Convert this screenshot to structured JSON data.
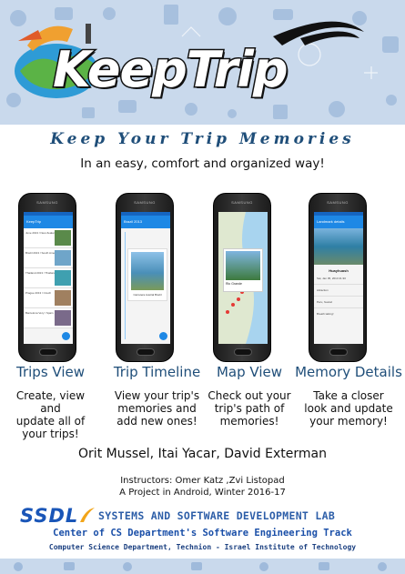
{
  "logo": {
    "title": "KeepTrip"
  },
  "tagline": "Keep Your Trip Memories",
  "subtagline": "In an easy, comfort and organized way!",
  "phones": [
    {
      "brand": "SAMSUNG",
      "app_title": "KeepTrip",
      "trips": [
        "June 2013 / New Zealand",
        "Brazil 2013 / South America",
        "Thailand 2013 / Thailand",
        "Prague 2013 / Czech",
        "Barcelona Very / Spain"
      ]
    },
    {
      "brand": "SAMSUNG",
      "app_title": "Brazil 2013",
      "memory_title": "Carretera Austral Brazil"
    },
    {
      "brand": "SAMSUNG",
      "place_label": "Rio Grande"
    },
    {
      "brand": "SAMSUNG",
      "app_title": "Landmark details",
      "memory_name": "Huayhuash",
      "memory_date": "Sat, Jan 05, 2013 21:30",
      "attraction": "Attraction",
      "location": "Peru, huaraz",
      "note": "Breath taking!"
    }
  ],
  "features": [
    {
      "title": "Trips View",
      "body": [
        "Create, view and",
        "update all of",
        "your trips!"
      ]
    },
    {
      "title": "Trip Timeline",
      "body": [
        "View your trip's",
        "memories and",
        "add new ones!"
      ]
    },
    {
      "title": "Map View",
      "body": [
        "Check out your",
        "trip's path of",
        "memories!"
      ]
    },
    {
      "title": "Memory Details",
      "body": [
        "Take a closer",
        "look and update",
        "your memory!"
      ]
    }
  ],
  "authors": "Orit Mussel, Itai Yacar, David Exterman",
  "instructors": "Instructors: Omer Katz ,Zvi Listopad",
  "project": "A Project in Android, Winter 2016-17",
  "lab": {
    "abbr": "SSDL",
    "name": "SYSTEMS AND SOFTWARE DEVELOPMENT LAB",
    "track": "Center of CS Department's Software Engineering Track",
    "institute": "Computer Science Department, Technion - Israel Institute of Technology"
  },
  "colors": {
    "title_blue": "#1f4e79",
    "banner": "#c9d9ec",
    "app_blue": "#1e88e5"
  }
}
